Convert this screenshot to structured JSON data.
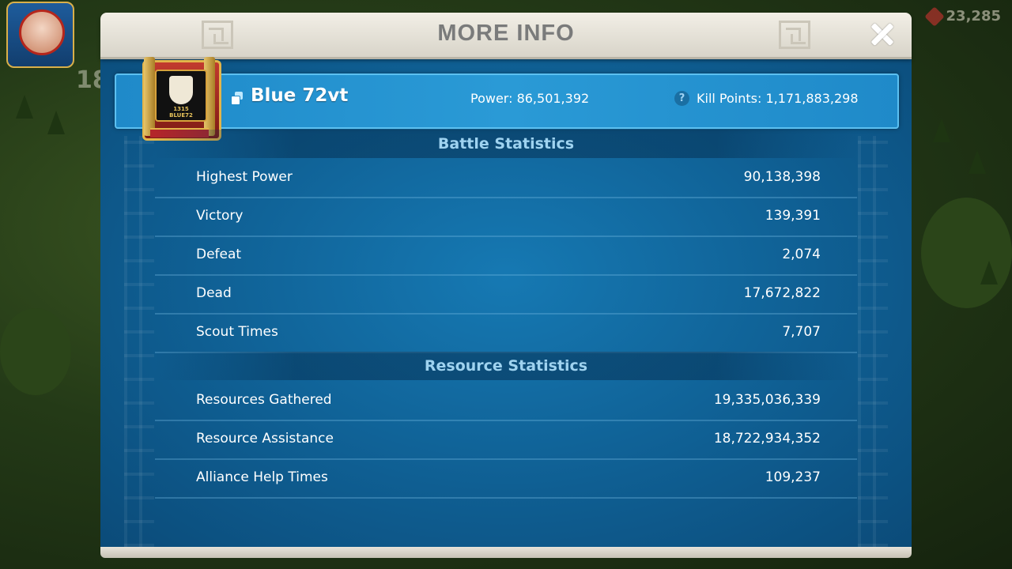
{
  "hud": {
    "level": "18",
    "gems": "23,285"
  },
  "modal": {
    "title": "MORE INFO"
  },
  "player": {
    "emblem_tag": "1315\nBLUE72",
    "name": "Blue 72vt",
    "power": "Power: 86,501,392",
    "kill_points": "Kill Points: 1,171,883,298"
  },
  "battle": {
    "heading": "Battle Statistics",
    "rows": [
      {
        "label": "Highest Power",
        "value": "90,138,398"
      },
      {
        "label": "Victory",
        "value": "139,391"
      },
      {
        "label": "Defeat",
        "value": "2,074"
      },
      {
        "label": "Dead",
        "value": "17,672,822"
      },
      {
        "label": "Scout Times",
        "value": "7,707"
      }
    ]
  },
  "resource": {
    "heading": "Resource Statistics",
    "rows": [
      {
        "label": "Resources Gathered",
        "value": "19,335,036,339"
      },
      {
        "label": "Resource Assistance",
        "value": "18,722,934,352"
      },
      {
        "label": "Alliance Help Times",
        "value": "109,237"
      }
    ]
  },
  "icons": {
    "close": "close-icon",
    "copy": "copy-icon",
    "help": "help-icon",
    "gem": "gem-icon"
  }
}
